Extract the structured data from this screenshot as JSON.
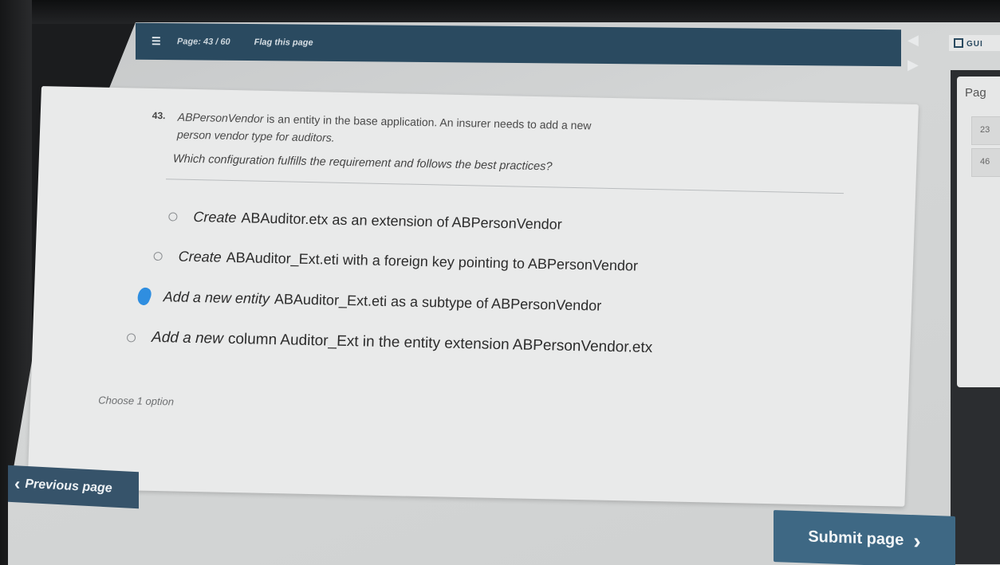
{
  "topbar": {
    "menu_icon": "☰",
    "page_indicator": "Page: 43 / 60",
    "flag_label": "Flag this page"
  },
  "brand": {
    "text": "GUI"
  },
  "nav": {
    "prev_icon": "◀",
    "next_icon": "▶"
  },
  "side_panel": {
    "title": "Pag",
    "cells": [
      "23",
      "46"
    ]
  },
  "question": {
    "number": "43.",
    "text_entity": "ABPersonVendor",
    "text_main": " is an entity in the base application. An insurer needs to add a new",
    "text_line2": "person vendor type for auditors.",
    "ask": "Which configuration fulfills the requirement and follows the best practices?",
    "options": [
      {
        "verb": "Create",
        "label": "ABAuditor.etx as an extension of ABPersonVendor",
        "selected": false
      },
      {
        "verb": "Create",
        "label": "ABAuditor_Ext.eti with a foreign key pointing to ABPersonVendor",
        "selected": false
      },
      {
        "verb": "Add a new entity",
        "label": "ABAuditor_Ext.eti as a subtype of ABPersonVendor",
        "selected": true
      },
      {
        "verb": "Add a new",
        "label": "column Auditor_Ext in the entity extension ABPersonVendor.etx",
        "selected": false
      }
    ],
    "hint": "Choose 1 option"
  },
  "buttons": {
    "prev_label": "Previous page",
    "prev_icon": "‹",
    "submit_label": "Submit page",
    "submit_icon": "›"
  },
  "colors": {
    "topbar": "#2a4a60",
    "submit": "#3e6884",
    "selected_radio": "#2f8ee0"
  }
}
